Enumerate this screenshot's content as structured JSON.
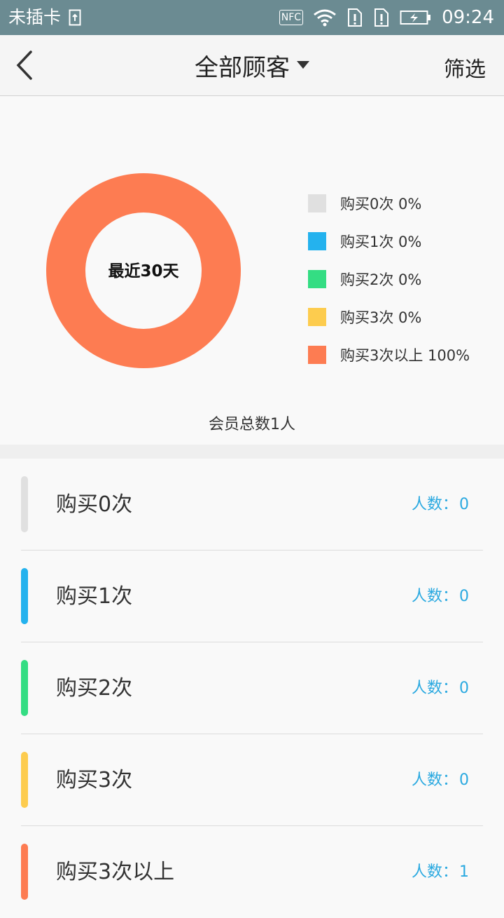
{
  "statusbar": {
    "carrier": "未插卡",
    "nfc": "NFC",
    "time": "09:24"
  },
  "header": {
    "back_icon": "chevron-left-icon",
    "title": "全部顾客",
    "title_dropdown_icon": "caret-down-icon",
    "filter_label": "筛选"
  },
  "chart": {
    "center_label": "最近30天",
    "total_text": "会员总数1人",
    "legend": [
      {
        "label": "购买0次 0%",
        "color": "#e0e0e0"
      },
      {
        "label": "购买1次 0%",
        "color": "#24b2ee"
      },
      {
        "label": "购买2次 0%",
        "color": "#34dd83"
      },
      {
        "label": "购买3次 0%",
        "color": "#fdcc4e"
      },
      {
        "label": "购买3次以上 100%",
        "color": "#fd7c52"
      }
    ]
  },
  "chart_data": {
    "type": "pie",
    "categories": [
      "购买0次",
      "购买1次",
      "购买2次",
      "购买3次",
      "购买3次以上"
    ],
    "values": [
      0,
      0,
      0,
      0,
      100
    ],
    "colors": [
      "#e0e0e0",
      "#24b2ee",
      "#34dd83",
      "#fdcc4e",
      "#fd7c52"
    ],
    "title": "最近30天",
    "legend_position": "right"
  },
  "list": {
    "items": [
      {
        "label": "购买0次",
        "count_prefix": "人数：",
        "count": "0",
        "color": "#e0e0e0"
      },
      {
        "label": "购买1次",
        "count_prefix": "人数：",
        "count": "0",
        "color": "#24b2ee"
      },
      {
        "label": "购买2次",
        "count_prefix": "人数：",
        "count": "0",
        "color": "#34dd83"
      },
      {
        "label": "购买3次",
        "count_prefix": "人数：",
        "count": "0",
        "color": "#fdcc4e"
      },
      {
        "label": "购买3次以上",
        "count_prefix": "人数：",
        "count": "1",
        "color": "#fd7c52"
      }
    ]
  }
}
